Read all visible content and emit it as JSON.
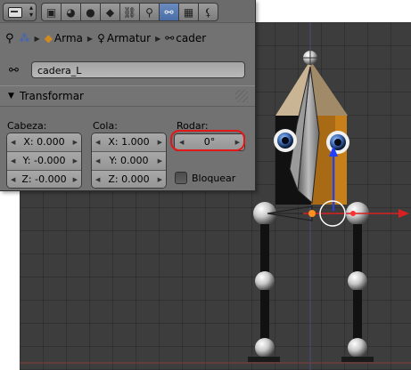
{
  "viewport": {
    "background": "#3d3d3d",
    "x_axis_color": "#d82020",
    "y_axis_color": "#2040ff"
  },
  "topbar": {
    "editor_type_icon": "editor-type-icon",
    "tabs": [
      {
        "icon": "render-icon",
        "glyph": "▣"
      },
      {
        "icon": "scene-icon",
        "glyph": "◕"
      },
      {
        "icon": "world-icon",
        "glyph": "●"
      },
      {
        "icon": "object-icon",
        "glyph": "◆"
      },
      {
        "icon": "constraints-icon",
        "glyph": "⛓"
      },
      {
        "icon": "armature-data-icon",
        "glyph": "⚲"
      },
      {
        "icon": "bone-icon",
        "glyph": "⚯"
      },
      {
        "icon": "material-icon",
        "glyph": "▦"
      },
      {
        "icon": "bone-constraint-icon",
        "glyph": "⚸"
      }
    ]
  },
  "breadcrumb": {
    "object": "Arma",
    "armature": "Armatur",
    "bone": "cader"
  },
  "bone_name": "cadera_L",
  "section": {
    "title": "Transformar"
  },
  "cabeza": {
    "label": "Cabeza:",
    "x": "X: 0.000",
    "y": "Y: -0.000",
    "z": "Z: -0.000"
  },
  "cola": {
    "label": "Cola:",
    "x": "X: 1.000",
    "y": "Y: 0.000",
    "z": "Z: 0.000"
  },
  "rodar": {
    "label": "Rodar:",
    "value": "0°"
  },
  "bloquear": {
    "label": "Bloquear",
    "checked": false
  },
  "highlight_color": "#e01818"
}
